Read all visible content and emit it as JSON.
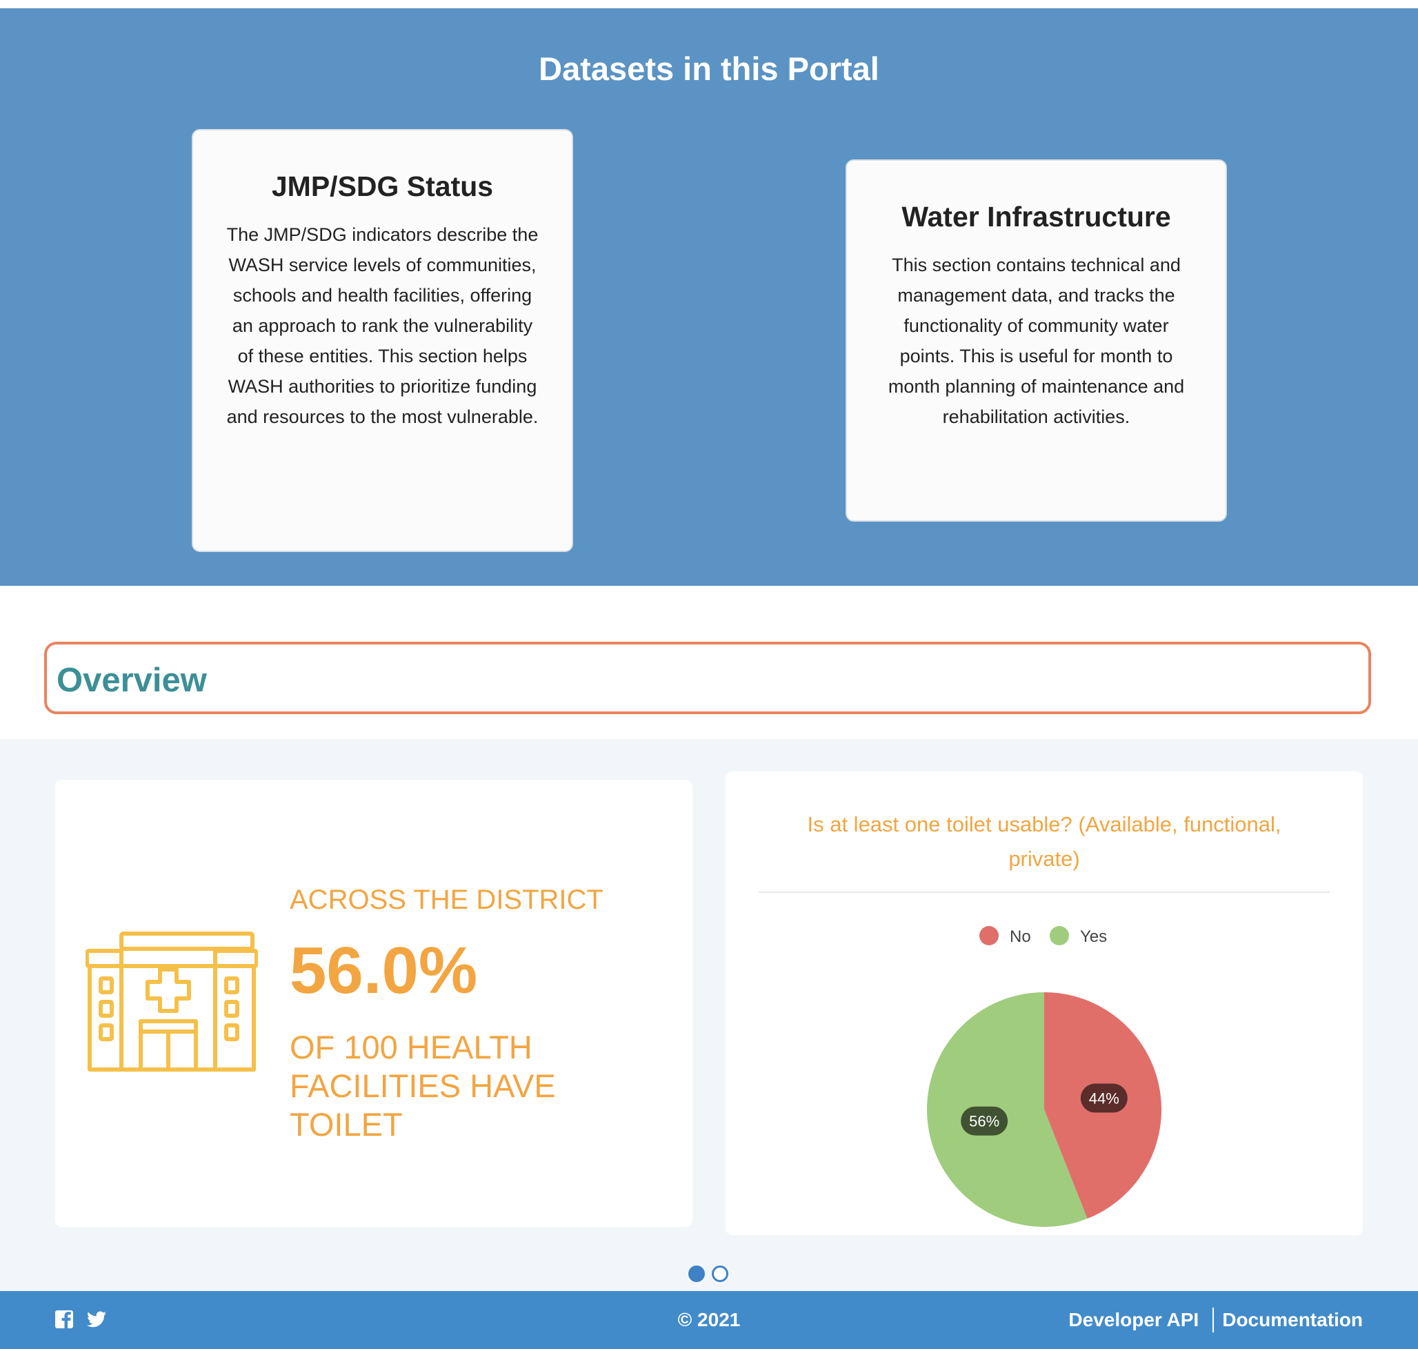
{
  "datasets": {
    "title": "Datasets in this Portal",
    "cards": [
      {
        "title": "JMP/SDG Status",
        "description": "The JMP/SDG indicators describe the WASH service levels of communities, schools and health facilities, offering an approach to rank the vulnerability of these entities. This section helps WASH authorities to prioritize funding and resources to the most vulnerable."
      },
      {
        "title": "Water Infrastructure",
        "description": "This section contains technical and management data, and tracks the functionality of community water points. This is useful for month to month planning of maintenance and rehabilitation activities."
      }
    ]
  },
  "overview": {
    "title": "Overview"
  },
  "stat": {
    "icon": "hospital-icon",
    "line1": "ACROSS THE DISTRICT",
    "value": "56.0%",
    "line2": "OF 100 HEALTH FACILITIES HAVE TOILET"
  },
  "chart_data": {
    "type": "pie",
    "title": "Is at least one toilet usable? (Available, functional, private)",
    "categories": [
      "No",
      "Yes"
    ],
    "values": [
      44,
      56
    ],
    "data_labels": [
      "44%",
      "56%"
    ],
    "colors": [
      "#e06f6a",
      "#a0cc7e"
    ],
    "legend": "top"
  },
  "carousel": {
    "total": 2,
    "active": 1
  },
  "footer": {
    "copyright": "© 2021",
    "links": [
      "Developer API",
      "Documentation"
    ],
    "social": [
      "facebook-icon",
      "twitter-icon"
    ]
  },
  "colors": {
    "datasets_bg": "#5b93c4",
    "accent_orange": "#f2a541",
    "overview_border": "#e8845e",
    "overview_title": "#3c8f96",
    "footer_bg": "#428bca"
  }
}
